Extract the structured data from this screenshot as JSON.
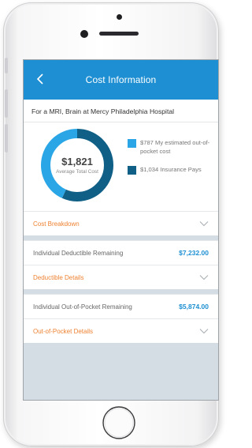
{
  "header": {
    "title": "Cost Information"
  },
  "procedure": "For a MRI, Brain at Mercy Philadelphia Hospital",
  "summary": {
    "total_value": "$1,821",
    "total_label": "Average Total Cost",
    "legend": [
      {
        "text": "$787 My estimated out-of-pocket cost",
        "color": "#2aa6e6"
      },
      {
        "text": "$1,034 Insurance Pays",
        "color": "#0f5f86"
      }
    ]
  },
  "chart_data": {
    "type": "pie",
    "categories": [
      "My estimated out-of-pocket cost",
      "Insurance Pays"
    ],
    "values": [
      787,
      1034
    ],
    "title": "",
    "center_value": "$1,821"
  },
  "sections": {
    "cost_breakdown": "Cost Breakdown",
    "deductible_label": "Individual Deductible Remaining",
    "deductible_value": "$7,232.00",
    "deductible_details": "Deductible Details",
    "oop_label": "Individual Out-of-Pocket Remaining",
    "oop_value": "$5,874.00",
    "oop_details": "Out-of-Pocket Details"
  },
  "colors": {
    "accent": "#1d8fd2",
    "link": "#ee8131",
    "insurance": "#0f5f86",
    "oop": "#2aa6e6"
  }
}
